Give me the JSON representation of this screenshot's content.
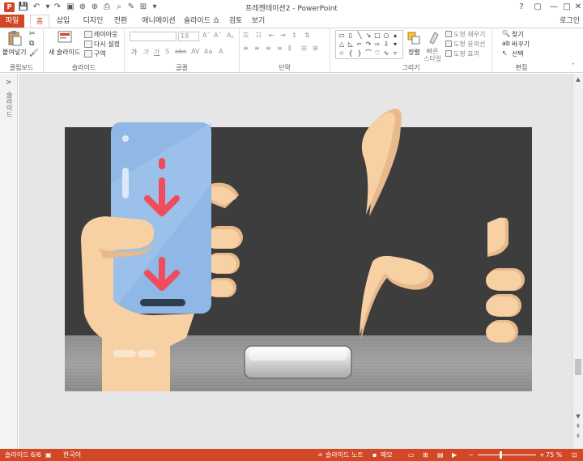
{
  "window": {
    "title": "프레젠테이션2 - PowerPoint",
    "app_icon_letter": "P",
    "controls": {
      "help": "?",
      "restore": "▢",
      "minimize": "—",
      "maximize": "□",
      "close": "✕"
    }
  },
  "quick_access": {
    "save_icon": "save-icon",
    "undo_icon": "undo-icon",
    "redo_icon": "redo-icon"
  },
  "tabs": {
    "file": "파일",
    "items": [
      "홈",
      "삽입",
      "디자인",
      "전환",
      "애니메이션",
      "슬라이드 쇼",
      "검토",
      "보기"
    ],
    "active_index": 0,
    "login": "로그인"
  },
  "ribbon": {
    "clipboard": {
      "paste": "붙여넣기",
      "label": "클립보드"
    },
    "slides": {
      "new_slide": "새 슬라이드",
      "layout": "레이아웃",
      "reset": "다시 설정",
      "section": "구역",
      "label": "슬라이드"
    },
    "font": {
      "size": "18",
      "label": "글꼴"
    },
    "paragraph": {
      "label": "단락"
    },
    "drawing": {
      "arrange": "정렬",
      "quick_styles": "빠른 스타일",
      "shape_fill": "도형 채우기",
      "shape_outline": "도형 윤곽선",
      "shape_effects": "도형 효과",
      "label": "그리기"
    },
    "editing": {
      "find": "찾기",
      "replace": "바꾸기",
      "select": "선택",
      "label": "편집"
    }
  },
  "thumbpane": {
    "vertical_label": "슬라이드",
    "expand_arrow": ">"
  },
  "statusbar": {
    "slide_info": "슬라이드 6/6",
    "language": "한국어",
    "notes": "슬라이드 노트",
    "comments": "메모",
    "zoom": "75 %"
  },
  "colors": {
    "accent": "#d24726",
    "slide_dark": "#3d3d3d",
    "floor_gray": "#9a9a9a",
    "phone_blue": "#8fb8e6",
    "skin": "#f7d0a4",
    "skin_shadow": "#e8b98a",
    "arrow_red": "#f24b5c"
  }
}
